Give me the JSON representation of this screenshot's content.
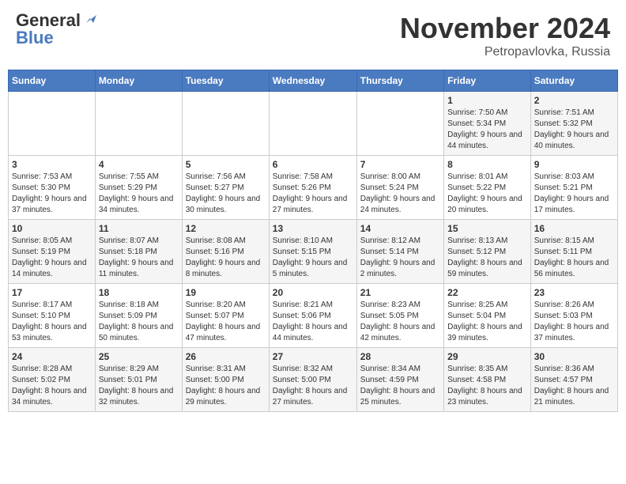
{
  "header": {
    "logo_general": "General",
    "logo_blue": "Blue",
    "month_year": "November 2024",
    "location": "Petropavlovka, Russia"
  },
  "weekdays": [
    "Sunday",
    "Monday",
    "Tuesday",
    "Wednesday",
    "Thursday",
    "Friday",
    "Saturday"
  ],
  "weeks": [
    [
      {
        "day": "",
        "info": ""
      },
      {
        "day": "",
        "info": ""
      },
      {
        "day": "",
        "info": ""
      },
      {
        "day": "",
        "info": ""
      },
      {
        "day": "",
        "info": ""
      },
      {
        "day": "1",
        "info": "Sunrise: 7:50 AM\nSunset: 5:34 PM\nDaylight: 9 hours and 44 minutes."
      },
      {
        "day": "2",
        "info": "Sunrise: 7:51 AM\nSunset: 5:32 PM\nDaylight: 9 hours and 40 minutes."
      }
    ],
    [
      {
        "day": "3",
        "info": "Sunrise: 7:53 AM\nSunset: 5:30 PM\nDaylight: 9 hours and 37 minutes."
      },
      {
        "day": "4",
        "info": "Sunrise: 7:55 AM\nSunset: 5:29 PM\nDaylight: 9 hours and 34 minutes."
      },
      {
        "day": "5",
        "info": "Sunrise: 7:56 AM\nSunset: 5:27 PM\nDaylight: 9 hours and 30 minutes."
      },
      {
        "day": "6",
        "info": "Sunrise: 7:58 AM\nSunset: 5:26 PM\nDaylight: 9 hours and 27 minutes."
      },
      {
        "day": "7",
        "info": "Sunrise: 8:00 AM\nSunset: 5:24 PM\nDaylight: 9 hours and 24 minutes."
      },
      {
        "day": "8",
        "info": "Sunrise: 8:01 AM\nSunset: 5:22 PM\nDaylight: 9 hours and 20 minutes."
      },
      {
        "day": "9",
        "info": "Sunrise: 8:03 AM\nSunset: 5:21 PM\nDaylight: 9 hours and 17 minutes."
      }
    ],
    [
      {
        "day": "10",
        "info": "Sunrise: 8:05 AM\nSunset: 5:19 PM\nDaylight: 9 hours and 14 minutes."
      },
      {
        "day": "11",
        "info": "Sunrise: 8:07 AM\nSunset: 5:18 PM\nDaylight: 9 hours and 11 minutes."
      },
      {
        "day": "12",
        "info": "Sunrise: 8:08 AM\nSunset: 5:16 PM\nDaylight: 9 hours and 8 minutes."
      },
      {
        "day": "13",
        "info": "Sunrise: 8:10 AM\nSunset: 5:15 PM\nDaylight: 9 hours and 5 minutes."
      },
      {
        "day": "14",
        "info": "Sunrise: 8:12 AM\nSunset: 5:14 PM\nDaylight: 9 hours and 2 minutes."
      },
      {
        "day": "15",
        "info": "Sunrise: 8:13 AM\nSunset: 5:12 PM\nDaylight: 8 hours and 59 minutes."
      },
      {
        "day": "16",
        "info": "Sunrise: 8:15 AM\nSunset: 5:11 PM\nDaylight: 8 hours and 56 minutes."
      }
    ],
    [
      {
        "day": "17",
        "info": "Sunrise: 8:17 AM\nSunset: 5:10 PM\nDaylight: 8 hours and 53 minutes."
      },
      {
        "day": "18",
        "info": "Sunrise: 8:18 AM\nSunset: 5:09 PM\nDaylight: 8 hours and 50 minutes."
      },
      {
        "day": "19",
        "info": "Sunrise: 8:20 AM\nSunset: 5:07 PM\nDaylight: 8 hours and 47 minutes."
      },
      {
        "day": "20",
        "info": "Sunrise: 8:21 AM\nSunset: 5:06 PM\nDaylight: 8 hours and 44 minutes."
      },
      {
        "day": "21",
        "info": "Sunrise: 8:23 AM\nSunset: 5:05 PM\nDaylight: 8 hours and 42 minutes."
      },
      {
        "day": "22",
        "info": "Sunrise: 8:25 AM\nSunset: 5:04 PM\nDaylight: 8 hours and 39 minutes."
      },
      {
        "day": "23",
        "info": "Sunrise: 8:26 AM\nSunset: 5:03 PM\nDaylight: 8 hours and 37 minutes."
      }
    ],
    [
      {
        "day": "24",
        "info": "Sunrise: 8:28 AM\nSunset: 5:02 PM\nDaylight: 8 hours and 34 minutes."
      },
      {
        "day": "25",
        "info": "Sunrise: 8:29 AM\nSunset: 5:01 PM\nDaylight: 8 hours and 32 minutes."
      },
      {
        "day": "26",
        "info": "Sunrise: 8:31 AM\nSunset: 5:00 PM\nDaylight: 8 hours and 29 minutes."
      },
      {
        "day": "27",
        "info": "Sunrise: 8:32 AM\nSunset: 5:00 PM\nDaylight: 8 hours and 27 minutes."
      },
      {
        "day": "28",
        "info": "Sunrise: 8:34 AM\nSunset: 4:59 PM\nDaylight: 8 hours and 25 minutes."
      },
      {
        "day": "29",
        "info": "Sunrise: 8:35 AM\nSunset: 4:58 PM\nDaylight: 8 hours and 23 minutes."
      },
      {
        "day": "30",
        "info": "Sunrise: 8:36 AM\nSunset: 4:57 PM\nDaylight: 8 hours and 21 minutes."
      }
    ]
  ]
}
